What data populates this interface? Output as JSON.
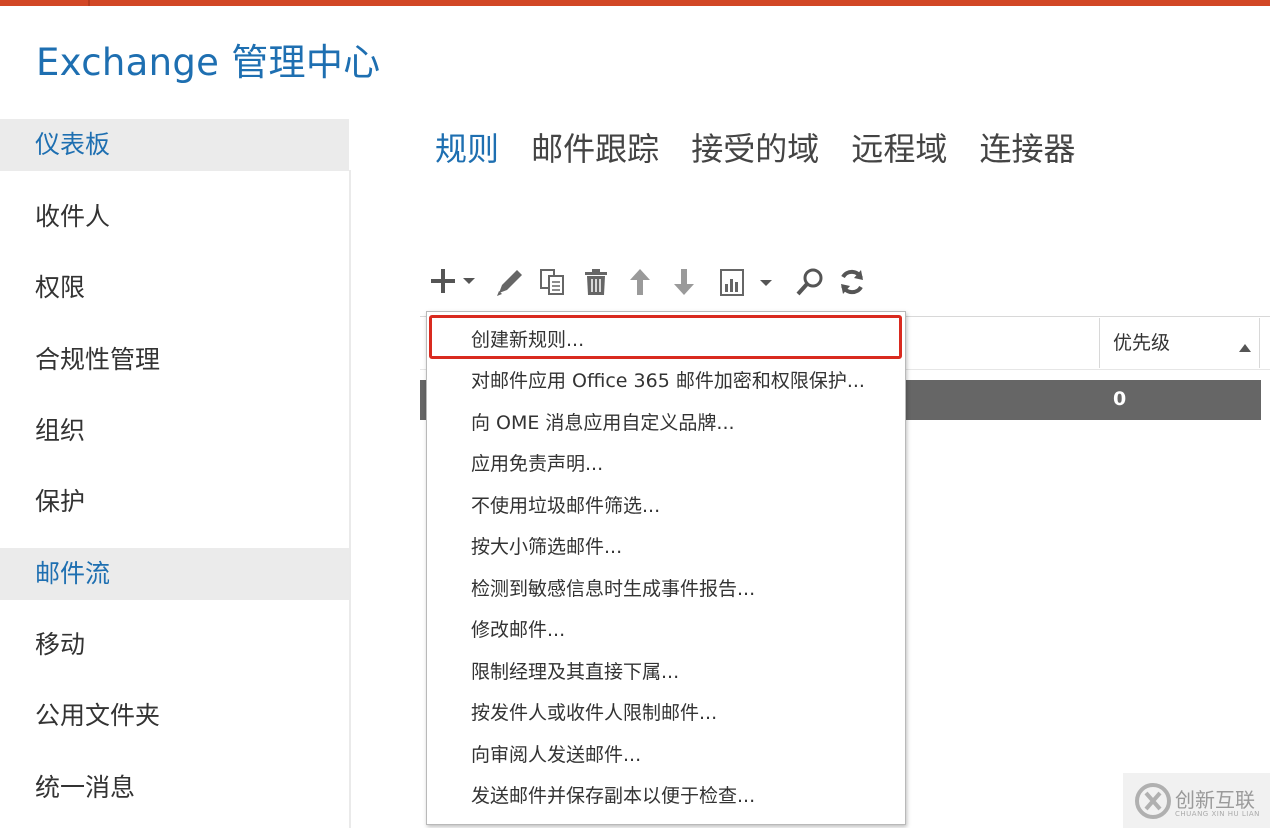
{
  "app": {
    "title": "Exchange 管理中心"
  },
  "colors": {
    "accent": "#1e6fb1",
    "topbar": "#d24726",
    "highlight": "#d92a1f",
    "selected_row": "#666666"
  },
  "sidebar": {
    "items": [
      {
        "label": "仪表板",
        "selected": true
      },
      {
        "label": "收件人",
        "selected": false
      },
      {
        "label": "权限",
        "selected": false
      },
      {
        "label": "合规性管理",
        "selected": false
      },
      {
        "label": "组织",
        "selected": false
      },
      {
        "label": "保护",
        "selected": false
      },
      {
        "label": "邮件流",
        "selected": true
      },
      {
        "label": "移动",
        "selected": false
      },
      {
        "label": "公用文件夹",
        "selected": false
      },
      {
        "label": "统一消息",
        "selected": false
      }
    ]
  },
  "tabs": [
    {
      "label": "规则",
      "active": true
    },
    {
      "label": "邮件跟踪",
      "active": false
    },
    {
      "label": "接受的域",
      "active": false
    },
    {
      "label": "远程域",
      "active": false
    },
    {
      "label": "连接器",
      "active": false
    }
  ],
  "toolbar": {
    "icons": [
      "add-icon",
      "chevron-down-icon",
      "edit-icon",
      "copy-icon",
      "delete-icon",
      "arrow-up-icon",
      "arrow-down-icon",
      "report-icon",
      "search-icon",
      "refresh-icon"
    ]
  },
  "grid": {
    "columns": [
      {
        "label": "优先级",
        "sort": "ascending"
      }
    ],
    "rows": [
      {
        "priority": "0",
        "selected": true
      }
    ]
  },
  "dropdown": {
    "items": [
      "创建新规则...",
      "对邮件应用 Office 365 邮件加密和权限保护...",
      "向 OME 消息应用自定义品牌...",
      "应用免责声明...",
      "不使用垃圾邮件筛选...",
      "按大小筛选邮件...",
      "检测到敏感信息时生成事件报告...",
      "修改邮件...",
      "限制经理及其直接下属...",
      "按发件人或收件人限制邮件...",
      "向审阅人发送邮件...",
      "发送邮件并保存副本以便于检查..."
    ],
    "highlighted_index": 0
  },
  "watermark": {
    "text": "创新互联",
    "subtext": "CHUANG XIN HU LIAN"
  }
}
